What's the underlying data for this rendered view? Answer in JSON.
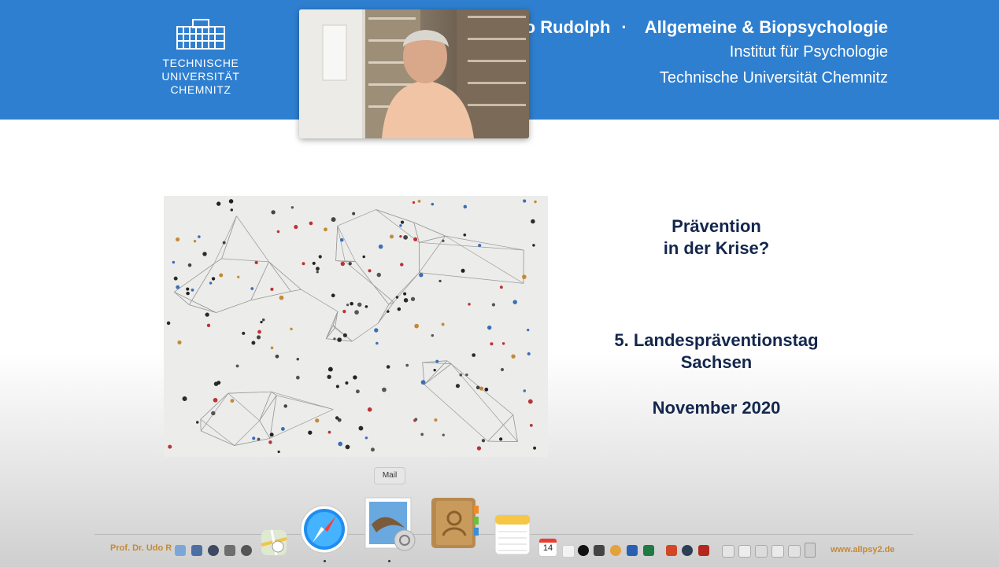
{
  "header": {
    "university_line1": "TECHNISCHE UNIVERSITÄT",
    "university_line2": "CHEMNITZ",
    "speaker": "Udo Rudolph",
    "separator": "·",
    "chair": "Allgemeine & Biopsychologie",
    "institute": "Institut für Psychologie",
    "university": "Technische Universität Chemnitz"
  },
  "slide": {
    "title_line1": "Prävention",
    "title_line2": "in der Krise?",
    "event_line1": "5. Landespräventionstag",
    "event_line2": "Sachsen",
    "date": "November 2020"
  },
  "footer": {
    "left": "Prof. Dr. Udo R",
    "right": "www.allpsy2.de"
  },
  "dock": {
    "tooltip": "Mail",
    "calendar_day": "14",
    "icons": [
      "maps-icon",
      "safari-icon",
      "mail-icon",
      "contacts-icon",
      "notes-icon",
      "calendar-icon",
      "music-icon",
      "appletv-icon",
      "word-icon",
      "excel-icon",
      "powerpoint-icon",
      "acrobat-icon",
      "trash-icon"
    ]
  },
  "colors": {
    "header_blue": "#2e7fd0",
    "title_navy": "#13264d",
    "footer_gold": "#c58a35"
  }
}
